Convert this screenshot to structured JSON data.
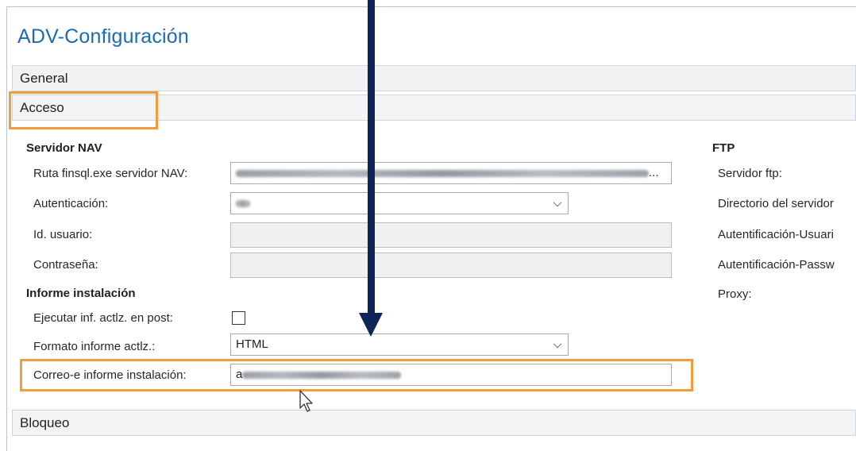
{
  "page": {
    "title": "ADV-Configuración"
  },
  "tabs": {
    "general": "General",
    "acceso": "Acceso",
    "bloqueo": "Bloqueo"
  },
  "servidor_nav": {
    "heading": "Servidor NAV",
    "ruta_label": "Ruta finsql.exe servidor NAV:",
    "ruta_value_suffix": "...",
    "autenticacion_label": "Autenticación:",
    "id_usuario_label": "Id. usuario:",
    "contrasena_label": "Contraseña:"
  },
  "informe_instalacion": {
    "heading": "Informe instalación",
    "ejecutar_label": "Ejecutar inf. actlz. en post:",
    "ejecutar_checked": false,
    "formato_label": "Formato informe actlz.:",
    "formato_value": "HTML",
    "correo_label": "Correo-e informe instalación:",
    "correo_value_prefix": "a"
  },
  "ftp": {
    "heading": "FTP",
    "servidor_label": "Servidor ftp:",
    "directorio_label": "Directorio del servidor",
    "usuario_label": "Autentificación-Usuari",
    "password_label": "Autentificación-Passw",
    "proxy_label": "Proxy:"
  },
  "icons": {
    "dropdown": "chevron-down-icon",
    "pointer": "mouse-pointer-icon",
    "annotation": "down-arrow-icon"
  },
  "colors": {
    "title": "#1c6ab3",
    "highlight": "#f39c3e",
    "arrow": "#0f2557"
  }
}
